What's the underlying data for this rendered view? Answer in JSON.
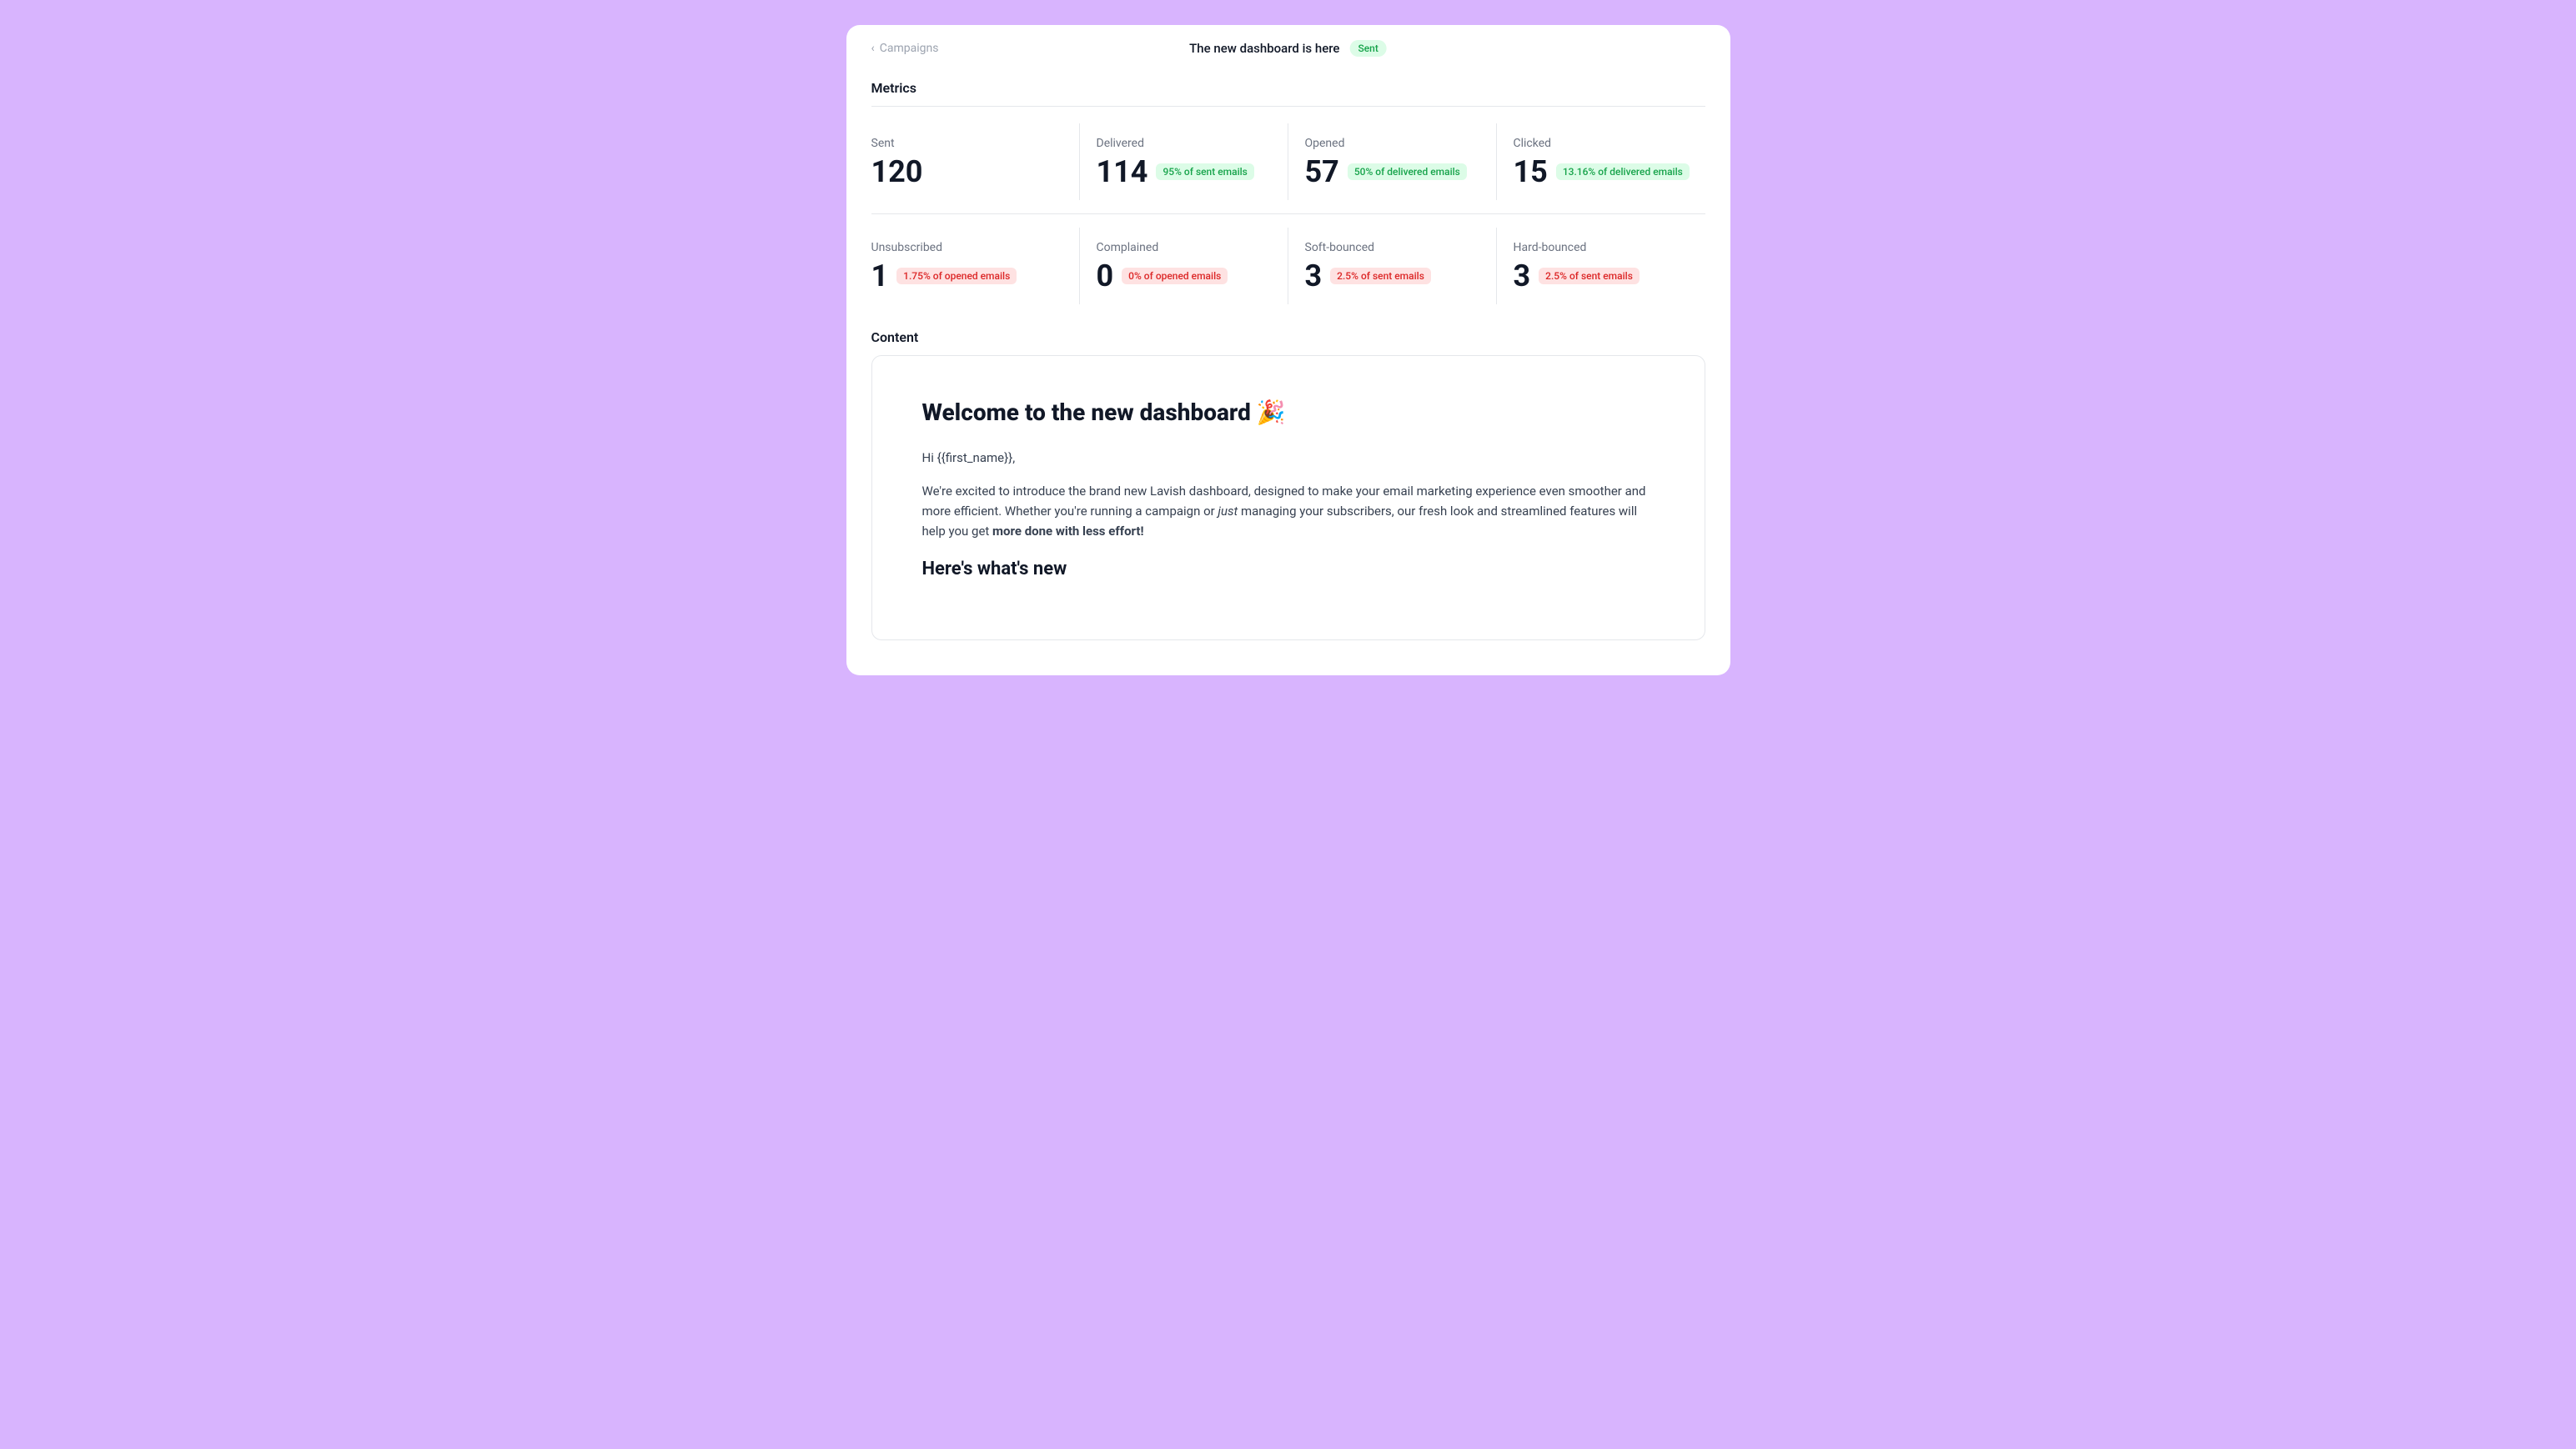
{
  "header": {
    "back_label": "Campaigns",
    "title": "The new dashboard is here",
    "status_badge": "Sent",
    "status_color": "#dcfce7",
    "status_text_color": "#16a34a"
  },
  "metrics": {
    "section_title": "Metrics",
    "rows": [
      [
        {
          "label": "Sent",
          "value": "120",
          "tag": null,
          "tag_type": null
        },
        {
          "label": "Delivered",
          "value": "114",
          "tag": "95% of sent emails",
          "tag_type": "green"
        },
        {
          "label": "Opened",
          "value": "57",
          "tag": "50% of delivered emails",
          "tag_type": "green"
        },
        {
          "label": "Clicked",
          "value": "15",
          "tag": "13.16% of delivered emails",
          "tag_type": "green"
        }
      ],
      [
        {
          "label": "Unsubscribed",
          "value": "1",
          "tag": "1.75% of opened emails",
          "tag_type": "red"
        },
        {
          "label": "Complained",
          "value": "0",
          "tag": "0% of opened emails",
          "tag_type": "red"
        },
        {
          "label": "Soft-bounced",
          "value": "3",
          "tag": "2.5% of sent emails",
          "tag_type": "red"
        },
        {
          "label": "Hard-bounced",
          "value": "3",
          "tag": "2.5% of sent emails",
          "tag_type": "red"
        }
      ]
    ]
  },
  "content": {
    "section_title": "Content",
    "email": {
      "subject": "Welcome to the new dashboard 🎉",
      "greeting": "Hi {{first_name}},",
      "paragraph1": "We're excited to introduce the brand new Lavish dashboard, designed to make your email marketing experience even smoother and more efficient. Whether you're running a campaign or just managing your subscribers, our fresh look and streamlined features will help you get more done with less effort!",
      "paragraph1_italic_word": "just",
      "paragraph1_bold_phrase": "more done with less effort!",
      "heading2": "Here's what's new"
    }
  },
  "icons": {
    "back_chevron": "‹"
  }
}
